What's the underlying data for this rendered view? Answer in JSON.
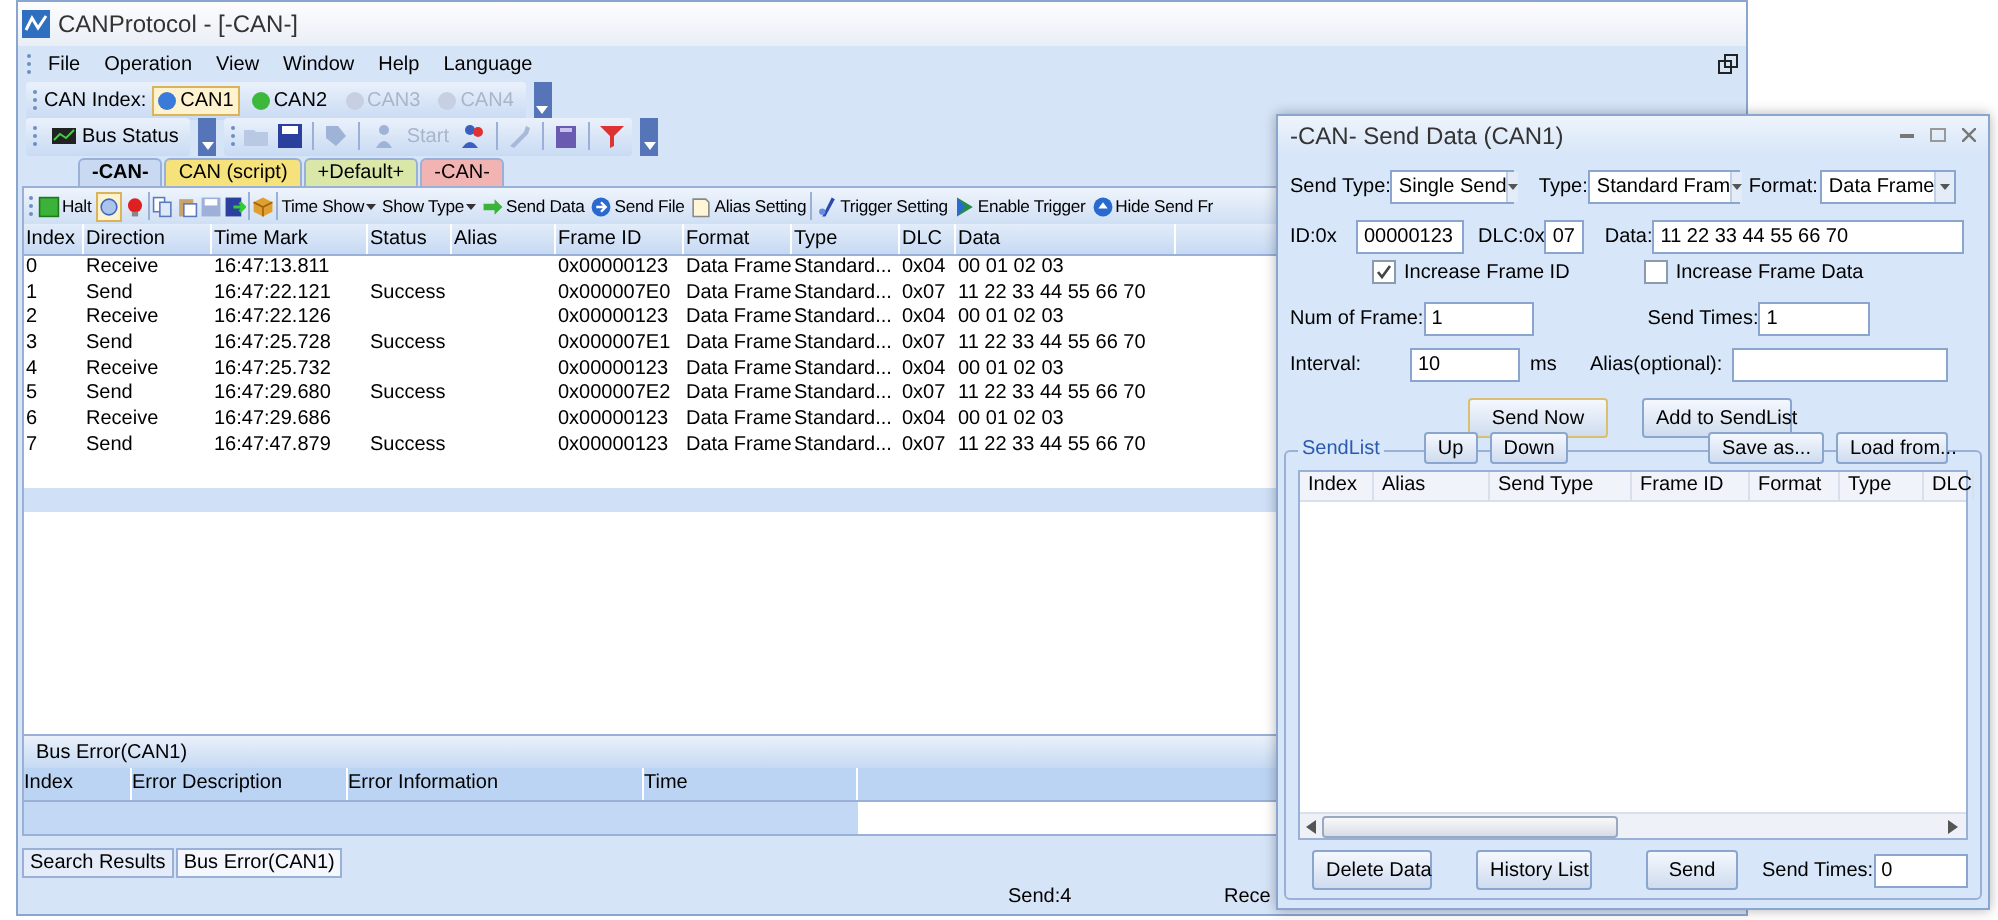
{
  "window": {
    "title": "CANProtocol - [-CAN-]"
  },
  "menu": [
    "File",
    "Operation",
    "View",
    "Window",
    "Help",
    "Language"
  ],
  "can_index": {
    "label": "CAN Index:",
    "items": [
      {
        "label": "CAN1",
        "selected": true,
        "disabled": false
      },
      {
        "label": "CAN2",
        "selected": false,
        "disabled": false
      },
      {
        "label": "CAN3",
        "selected": false,
        "disabled": true
      },
      {
        "label": "CAN4",
        "selected": false,
        "disabled": true
      }
    ]
  },
  "toolbar": {
    "bus_status": "Bus Status",
    "start": {
      "label": "Start",
      "disabled": true
    }
  },
  "doc_tabs": [
    {
      "label": "-CAN-",
      "selected": true,
      "color": "#c9d9f2"
    },
    {
      "label": "CAN (script)",
      "selected": false,
      "color": "#f5e27a"
    },
    {
      "label": "+Default+",
      "selected": false,
      "color": "#d9e8a8"
    },
    {
      "label": "-CAN-",
      "selected": false,
      "color": "#f2b3b3"
    }
  ],
  "toolbar2": [
    {
      "label": "Halt",
      "dropdown": false
    },
    {
      "label": "Time Show",
      "dropdown": true
    },
    {
      "label": "Show Type",
      "dropdown": true
    },
    {
      "label": "Send Data",
      "dropdown": false
    },
    {
      "label": "Send File",
      "dropdown": false
    },
    {
      "label": "Alias Setting",
      "dropdown": false
    },
    {
      "label": "Trigger Setting",
      "dropdown": false
    },
    {
      "label": "Enable Trigger",
      "dropdown": false
    },
    {
      "label": "Hide Send Fr",
      "dropdown": false
    }
  ],
  "table": {
    "columns": [
      "Index",
      "Direction",
      "Time Mark",
      "Status",
      "Alias",
      "Frame ID",
      "Format",
      "Type",
      "DLC",
      "Data"
    ],
    "rows": [
      [
        "0",
        "Receive",
        "16:47:13.811",
        "",
        "",
        "0x00000123",
        "Data Frame",
        "Standard...",
        "0x04",
        "00 01 02 03"
      ],
      [
        "1",
        "Send",
        "16:47:22.121",
        "Success",
        "",
        "0x000007E0",
        "Data Frame",
        "Standard...",
        "0x07",
        "11 22 33 44 55 66 70"
      ],
      [
        "2",
        "Receive",
        "16:47:22.126",
        "",
        "",
        "0x00000123",
        "Data Frame",
        "Standard...",
        "0x04",
        "00 01 02 03"
      ],
      [
        "3",
        "Send",
        "16:47:25.728",
        "Success",
        "",
        "0x000007E1",
        "Data Frame",
        "Standard...",
        "0x07",
        "11 22 33 44 55 66 70"
      ],
      [
        "4",
        "Receive",
        "16:47:25.732",
        "",
        "",
        "0x00000123",
        "Data Frame",
        "Standard...",
        "0x04",
        "00 01 02 03"
      ],
      [
        "5",
        "Send",
        "16:47:29.680",
        "Success",
        "",
        "0x000007E2",
        "Data Frame",
        "Standard...",
        "0x07",
        "11 22 33 44 55 66 70"
      ],
      [
        "6",
        "Receive",
        "16:47:29.686",
        "",
        "",
        "0x00000123",
        "Data Frame",
        "Standard...",
        "0x04",
        "00 01 02 03"
      ],
      [
        "7",
        "Send",
        "16:47:47.879",
        "Success",
        "",
        "0x00000123",
        "Data Frame",
        "Standard...",
        "0x07",
        "11 22 33 44 55 66 70"
      ]
    ]
  },
  "bus_error": {
    "title": "Bus Error(CAN1)",
    "columns": [
      "Index",
      "Error Description",
      "Error Information",
      "Time"
    ]
  },
  "bottom_tabs": [
    {
      "label": "Search Results",
      "selected": false
    },
    {
      "label": "Bus Error(CAN1)",
      "selected": true
    }
  ],
  "status_bar": [
    "Send:4",
    "Rece"
  ],
  "dialog": {
    "title": "-CAN- Send Data (CAN1)",
    "send_type": {
      "label": "Send Type:",
      "value": "Single Send"
    },
    "type": {
      "label": "Type:",
      "value": "Standard Fram"
    },
    "format": {
      "label": "Format:",
      "value": "Data Frame"
    },
    "id": {
      "label": "ID:0x",
      "value": "00000123"
    },
    "dlc": {
      "label": "DLC:0x",
      "value": "07"
    },
    "data": {
      "label": "Data:",
      "value": "11 22 33 44 55 66 70"
    },
    "increase_id": {
      "label": "Increase Frame ID",
      "checked": true
    },
    "increase_data": {
      "label": "Increase Frame Data",
      "checked": false
    },
    "num_of_frame": {
      "label": "Num of Frame:",
      "value": "1"
    },
    "send_times": {
      "label": "Send Times:",
      "value": "1"
    },
    "interval": {
      "label": "Interval:",
      "value": "10",
      "unit": "ms"
    },
    "alias": {
      "label": "Alias(optional):"
    },
    "buttons": [
      "Send Now",
      "Add to SendList"
    ],
    "send_list": {
      "title": "SendList",
      "buttons": [
        "Up",
        "Down",
        "Save as...",
        "Load from..."
      ],
      "columns": [
        "Index",
        "Alias",
        "Send Type",
        "Frame ID",
        "Format",
        "Type",
        "DLC"
      ]
    },
    "bottom_buttons": [
      "Delete Data",
      "History List",
      "Send"
    ],
    "bottom_send_times": {
      "label": "Send Times:",
      "value": "0"
    }
  }
}
